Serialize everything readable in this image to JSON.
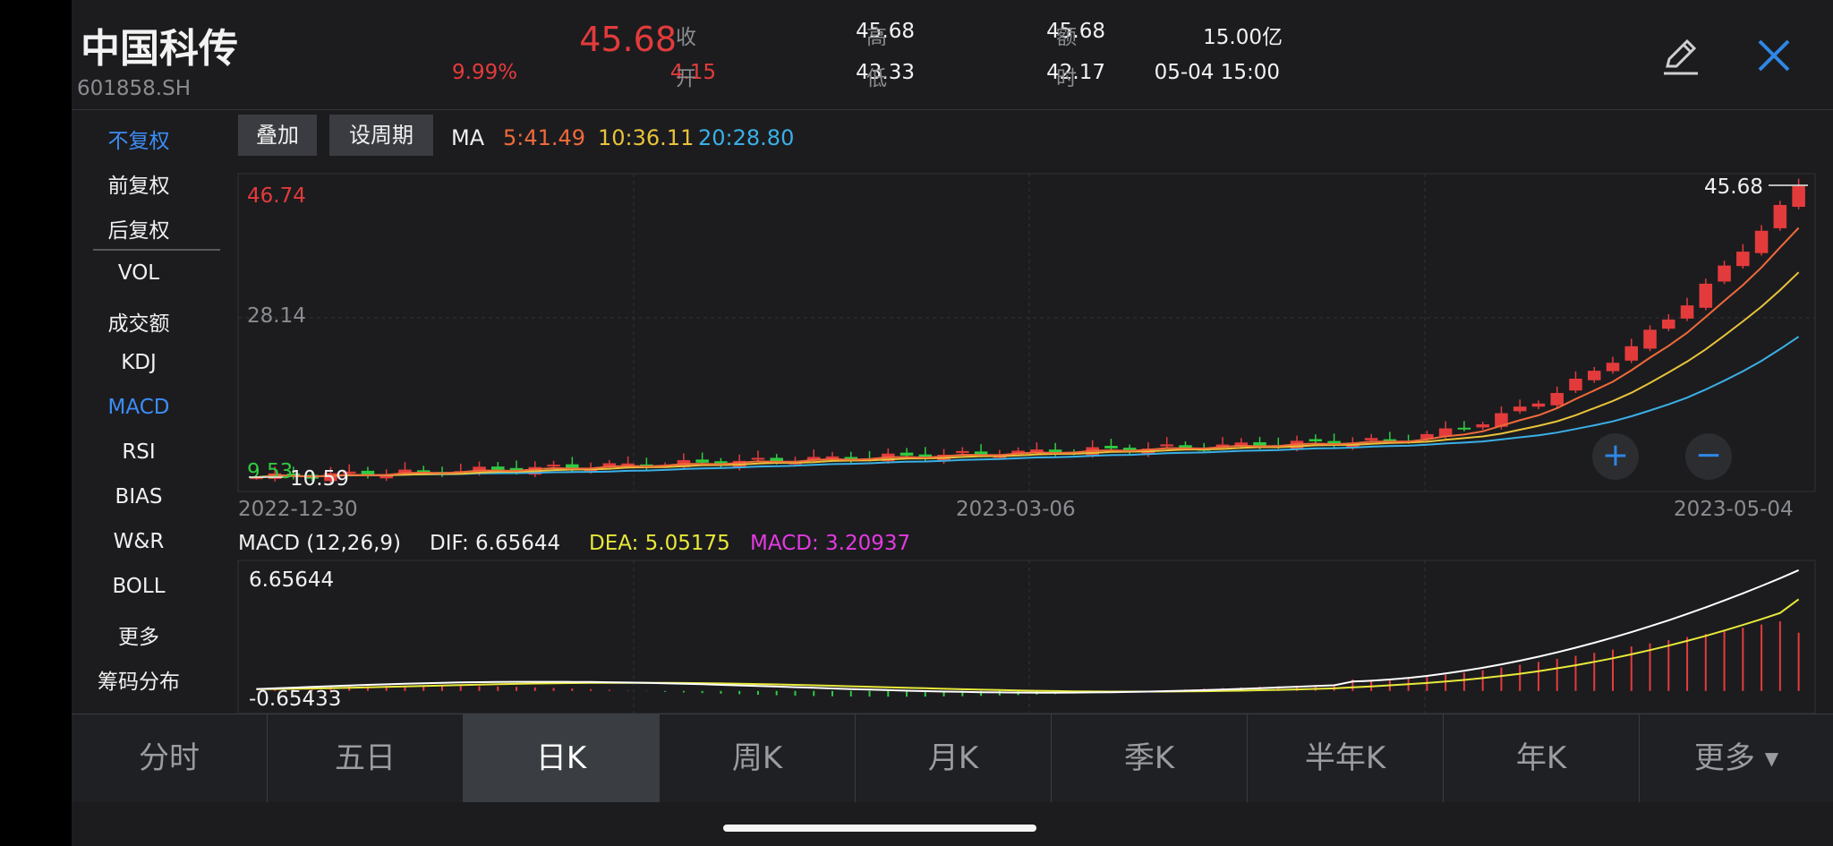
{
  "stock": {
    "name": "中国科传",
    "code": "601858.SH",
    "price": "45.68",
    "change_pct": "9.99%",
    "change": "4.15"
  },
  "quote": {
    "close_label": "收",
    "close": "45.68",
    "high_label": "高",
    "high": "45.68",
    "amount_label": "额",
    "amount": "15.00亿",
    "open_label": "开",
    "open": "43.33",
    "low_label": "低",
    "low": "42.17",
    "time_label": "时",
    "time": "05-04 15:00"
  },
  "sidebar": {
    "items": [
      "不复权",
      "前复权",
      "后复权",
      "VOL",
      "成交额",
      "KDJ",
      "MACD",
      "RSI",
      "BIAS",
      "W&R",
      "BOLL",
      "更多",
      "筹码分布"
    ]
  },
  "toolbar": {
    "overlay_label": "叠加",
    "period_label": "设周期",
    "ma_label": "MA",
    "ma5": "5:41.49",
    "ma10": "10:36.11",
    "ma20": "20:28.80"
  },
  "colors": {
    "up": "#e33b3b",
    "down": "#2ecc40",
    "ma5": "#f06a3a",
    "ma10": "#e8c33a",
    "ma20": "#3ab0e6",
    "accent": "#3d8df5",
    "dif": "#ffffff",
    "dea": "#e8e83a",
    "macd": "#e33ae0"
  },
  "main_chart": {
    "y_max_label": "46.74",
    "y_mid_label": "28.14",
    "y_min_label": "9.53",
    "low_marker": "10.59",
    "last_price_marker": "45.68",
    "dates": [
      "2022-12-30",
      "2023-03-06",
      "2023-05-04"
    ]
  },
  "macd_panel": {
    "title": "MACD (12,26,9)",
    "dif_label": "DIF: 6.65644",
    "dea_label": "DEA: 5.05175",
    "macd_label": "MACD: 3.20937",
    "y_max_label": "6.65644",
    "y_min_label": "-0.65433"
  },
  "zoom": {
    "plus": "+",
    "minus": "−"
  },
  "tabs": [
    "分时",
    "五日",
    "日K",
    "周K",
    "月K",
    "季K",
    "半年K",
    "年K",
    "更多"
  ],
  "active_tab": "日K"
}
